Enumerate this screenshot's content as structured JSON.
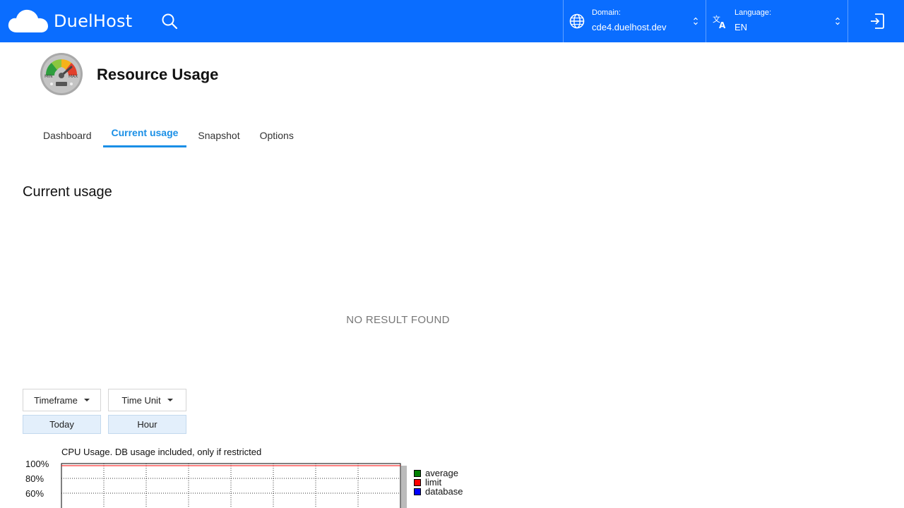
{
  "brand": {
    "name": "DuelHost",
    "accent": "#0a6dff"
  },
  "topbar": {
    "domain_label": "Domain:",
    "domain_value": "cde4.duelhost.dev",
    "language_label": "Language:",
    "language_value": "EN",
    "icons": {
      "search": "search-icon",
      "domain": "globe-icon",
      "language": "translate-icon",
      "logout": "logout-icon"
    }
  },
  "header": {
    "title": "Resource Usage",
    "icon": "gauge-icon"
  },
  "tabs": [
    {
      "label": "Dashboard",
      "active": false
    },
    {
      "label": "Current usage",
      "active": true
    },
    {
      "label": "Snapshot",
      "active": false
    },
    {
      "label": "Options",
      "active": false
    }
  ],
  "section": {
    "title": "Current usage",
    "empty_message": "NO RESULT FOUND"
  },
  "filters": {
    "timeframe_label": "Timeframe",
    "timeframe_value": "Today",
    "timeunit_label": "Time Unit",
    "timeunit_value": "Hour"
  },
  "chart_data": {
    "type": "line",
    "title": "CPU Usage. DB usage included, only if restricted",
    "y_ticks": [
      "100%",
      "80%",
      "60%"
    ],
    "ylim": [
      60,
      100
    ],
    "grid": true,
    "legend_position": "right",
    "series": [
      {
        "name": "average",
        "color": "#008000",
        "values": []
      },
      {
        "name": "limit",
        "color": "#ff0000",
        "values": [
          100,
          100,
          100,
          100,
          100,
          100,
          100,
          100,
          100
        ]
      },
      {
        "name": "database",
        "color": "#0000ff",
        "values": []
      }
    ]
  }
}
